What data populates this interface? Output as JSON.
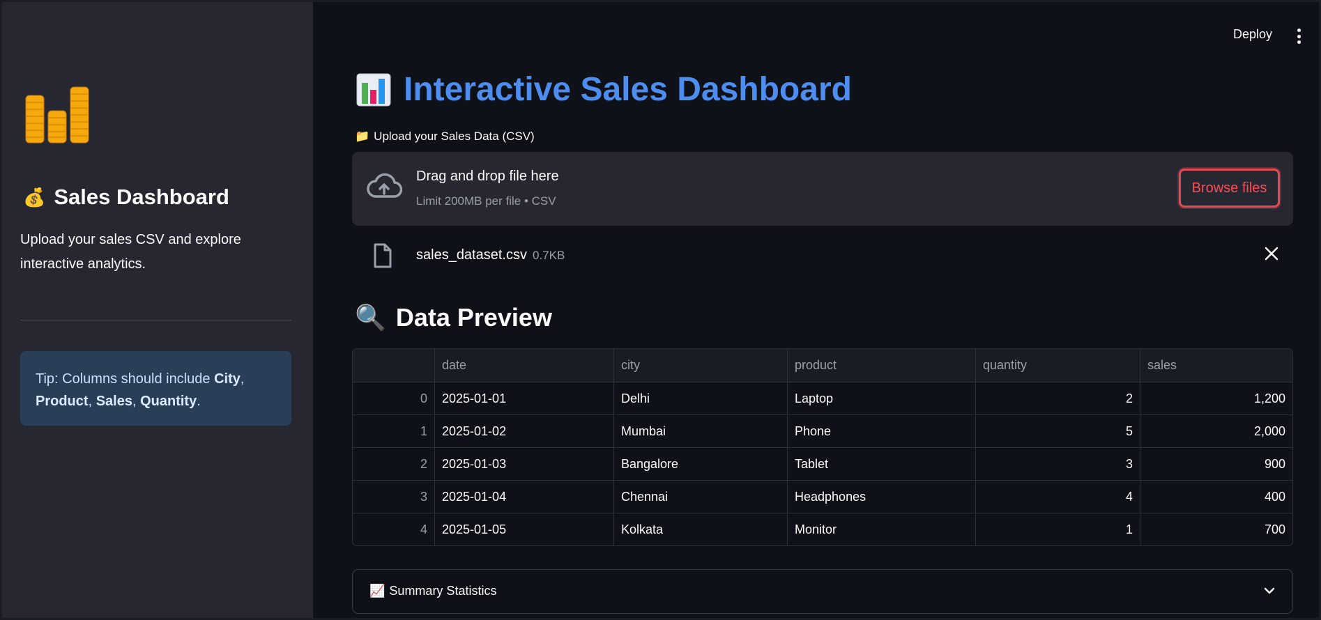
{
  "sidebar": {
    "title": "Sales Dashboard",
    "title_emoji": "💰",
    "description": "Upload your sales CSV and explore interactive analytics.",
    "tip": {
      "prefix": "Tip: Columns should include ",
      "col1": "City",
      "col2": "Product",
      "col3": "Sales",
      "col4": "Quantity",
      "sep": ", ",
      "end": "."
    }
  },
  "toolbar": {
    "deploy_label": "Deploy"
  },
  "main": {
    "title": "Interactive Sales Dashboard",
    "title_emoji": "📊",
    "upload_label": "Upload your Sales Data (CSV)",
    "upload_emoji": "📁",
    "dropzone": {
      "title": "Drag and drop file here",
      "subtitle": "Limit 200MB per file • CSV",
      "browse_label": "Browse files"
    },
    "file": {
      "name": "sales_dataset.csv",
      "size": "0.7KB"
    },
    "preview_title": "Data Preview",
    "preview_emoji": "🔍",
    "table": {
      "columns": [
        "",
        "date",
        "city",
        "product",
        "quantity",
        "sales"
      ],
      "rows": [
        [
          "0",
          "2025-01-01",
          "Delhi",
          "Laptop",
          "2",
          "1,200"
        ],
        [
          "1",
          "2025-01-02",
          "Mumbai",
          "Phone",
          "5",
          "2,000"
        ],
        [
          "2",
          "2025-01-03",
          "Bangalore",
          "Tablet",
          "3",
          "900"
        ],
        [
          "3",
          "2025-01-04",
          "Chennai",
          "Headphones",
          "4",
          "400"
        ],
        [
          "4",
          "2025-01-05",
          "Kolkata",
          "Monitor",
          "1",
          "700"
        ]
      ]
    },
    "summary_label": "Summary Statistics",
    "summary_emoji": "📈"
  },
  "colors": {
    "accent_title": "#4d8df0",
    "browse_red": "#ff4b55",
    "sidebar_bg": "#262730",
    "main_bg": "#0e1117",
    "tip_bg": "#2b3e57"
  },
  "icons": [
    "coins-stack-icon",
    "money-bag-icon",
    "bar-chart-icon",
    "folder-icon",
    "cloud-upload-icon",
    "file-icon",
    "close-icon",
    "magnifier-icon",
    "chart-up-icon",
    "chevron-down-icon",
    "kebab-menu-icon"
  ]
}
